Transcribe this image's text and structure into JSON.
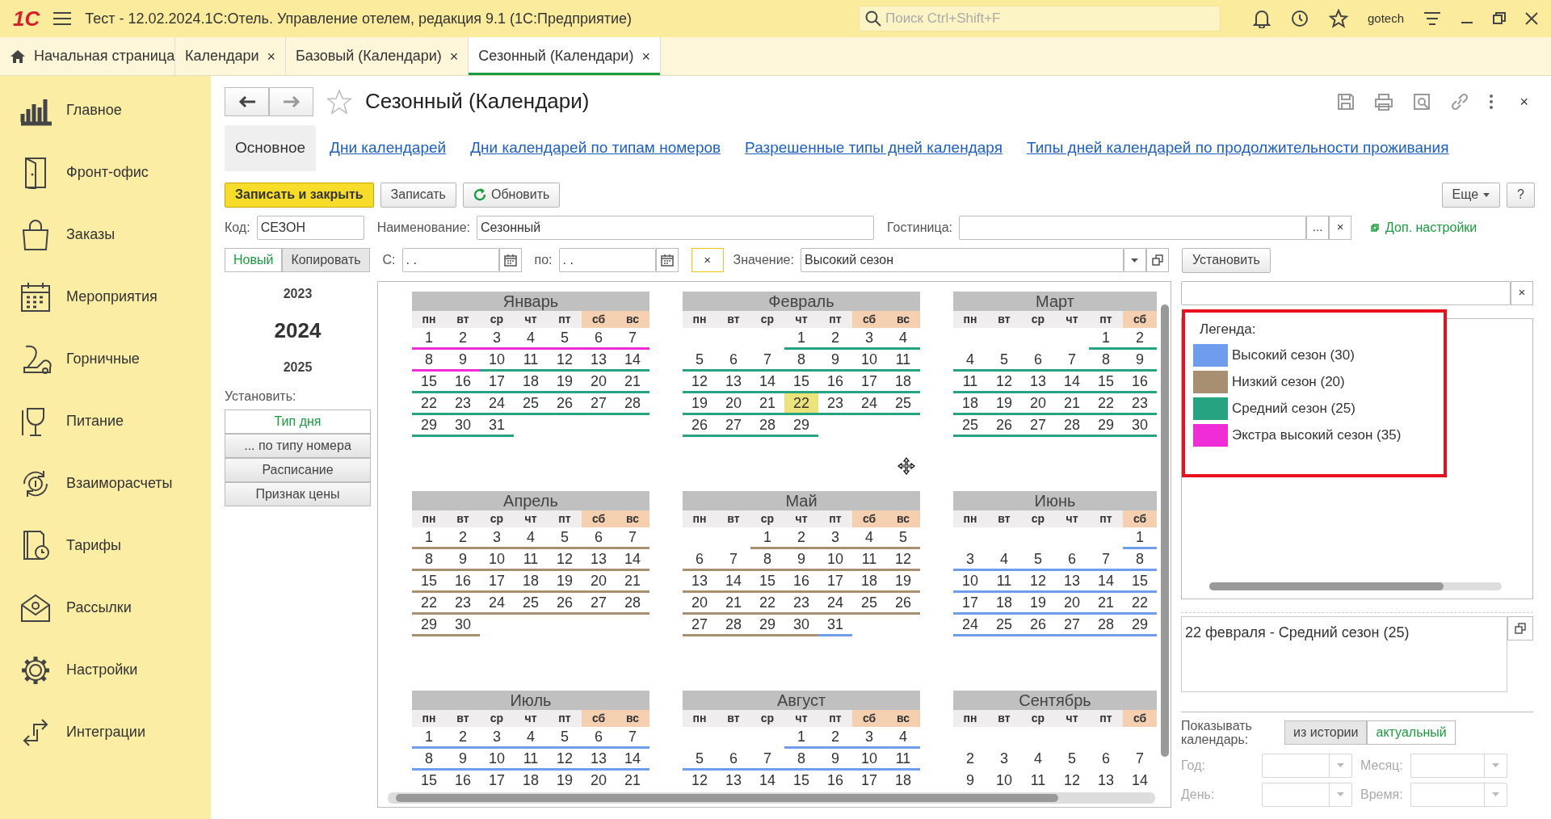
{
  "window": {
    "logo": "1С",
    "title": "Тест - 12.02.2024.1С:Отель. Управление отелем, редакция 9.1  (1С:Предприятие)",
    "search_placeholder": "Поиск Ctrl+Shift+F",
    "user": "gotech"
  },
  "tabs": [
    {
      "label": "Начальная страница",
      "selected": false,
      "kind": "home"
    },
    {
      "label": "Календари",
      "selected": false,
      "kind": "doc",
      "close": "×"
    },
    {
      "label": "Базовый (Календари)",
      "selected": false,
      "kind": "doc",
      "close": "×"
    },
    {
      "label": "Сезонный (Календари)",
      "selected": true,
      "kind": "doc",
      "close": "×"
    }
  ],
  "sidebar": [
    {
      "label": "Главное"
    },
    {
      "label": "Фронт-офис"
    },
    {
      "label": "Заказы"
    },
    {
      "label": "Мероприятия"
    },
    {
      "label": "Горничные"
    },
    {
      "label": "Питание"
    },
    {
      "label": "Взаиморасчеты"
    },
    {
      "label": "Тарифы"
    },
    {
      "label": "Рассылки"
    },
    {
      "label": "Настройки"
    },
    {
      "label": "Интеграции"
    }
  ],
  "form": {
    "title": "Сезонный (Календари)",
    "close": "×",
    "sections": [
      {
        "label": "Основное",
        "selected": true
      },
      {
        "label": "Дни календарей",
        "selected": false
      },
      {
        "label": "Дни календарей по типам номеров",
        "selected": false
      },
      {
        "label": "Разрешенные типы дней календаря",
        "selected": false
      },
      {
        "label": "Типы дней календарей по продолжительности проживания",
        "selected": false
      }
    ],
    "buttons": {
      "save_close": "Записать и закрыть",
      "save": "Записать",
      "refresh": "Обновить",
      "more": "Еще",
      "help": "?"
    },
    "code": {
      "label": "Код:",
      "value": "СЕЗОН"
    },
    "name": {
      "label": "Наименование:",
      "value": "Сезонный"
    },
    "hotel": {
      "label": "Гостиница:",
      "select": "...",
      "clear": "×"
    },
    "settings_link": "Доп. настройки",
    "modes": [
      {
        "label": "Новый",
        "selected": true
      },
      {
        "label": "Копировать",
        "selected": false
      }
    ],
    "from": {
      "label": "С:",
      "value": ". ."
    },
    "to": {
      "label": "по:",
      "value": ". ."
    },
    "clear": "×",
    "value": {
      "label": "Значение:",
      "value": "Высокий сезон"
    },
    "set_button": "Установить"
  },
  "years": [
    {
      "label": "2023",
      "selected": false
    },
    {
      "label": "2024",
      "selected": true
    },
    {
      "label": "2025",
      "selected": false
    }
  ],
  "set_label": "Установить:",
  "set_options": [
    {
      "label": "Тип дня",
      "selected": true
    },
    {
      "label": "... по типу номера",
      "selected": false
    },
    {
      "label": "Расписание",
      "selected": false
    },
    {
      "label": "Признак цены",
      "selected": false
    }
  ],
  "months": [
    {
      "name": "Январь",
      "weekdays": [
        {
          "label": "пн",
          "weekend": false
        },
        {
          "label": "вт",
          "weekend": false
        },
        {
          "label": "ср",
          "weekend": false
        },
        {
          "label": "чт",
          "weekend": false
        },
        {
          "label": "пт",
          "weekend": false
        },
        {
          "label": "сб",
          "weekend": true
        },
        {
          "label": "вс",
          "weekend": true
        }
      ],
      "weeks": [
        [
          {
            "day": "1",
            "color": "#f02cd7",
            "selected": false
          },
          {
            "day": "2",
            "color": "#f02cd7",
            "selected": false
          },
          {
            "day": "3",
            "color": "#f02cd7",
            "selected": false
          },
          {
            "day": "4",
            "color": "#f02cd7",
            "selected": false
          },
          {
            "day": "5",
            "color": "#f02cd7",
            "selected": false
          },
          {
            "day": "6",
            "color": "#f02cd7",
            "selected": false
          },
          {
            "day": "7",
            "color": "#f02cd7",
            "selected": false
          }
        ],
        [
          {
            "day": "8",
            "color": "#f02cd7",
            "selected": false
          },
          {
            "day": "9",
            "color": "#f02cd7",
            "selected": false
          },
          {
            "day": "10",
            "color": "#26a482",
            "selected": false
          },
          {
            "day": "11",
            "color": "#26a482",
            "selected": false
          },
          {
            "day": "12",
            "color": "#26a482",
            "selected": false
          },
          {
            "day": "13",
            "color": "#26a482",
            "selected": false
          },
          {
            "day": "14",
            "color": "#26a482",
            "selected": false
          }
        ],
        [
          {
            "day": "15",
            "color": "#26a482",
            "selected": false
          },
          {
            "day": "16",
            "color": "#26a482",
            "selected": false
          },
          {
            "day": "17",
            "color": "#26a482",
            "selected": false
          },
          {
            "day": "18",
            "color": "#26a482",
            "selected": false
          },
          {
            "day": "19",
            "color": "#26a482",
            "selected": false
          },
          {
            "day": "20",
            "color": "#26a482",
            "selected": false
          },
          {
            "day": "21",
            "color": "#26a482",
            "selected": false
          }
        ],
        [
          {
            "day": "22",
            "color": "#26a482",
            "selected": false
          },
          {
            "day": "23",
            "color": "#26a482",
            "selected": false
          },
          {
            "day": "24",
            "color": "#26a482",
            "selected": false
          },
          {
            "day": "25",
            "color": "#26a482",
            "selected": false
          },
          {
            "day": "26",
            "color": "#26a482",
            "selected": false
          },
          {
            "day": "27",
            "color": "#26a482",
            "selected": false
          },
          {
            "day": "28",
            "color": "#26a482",
            "selected": false
          }
        ],
        [
          {
            "day": "29",
            "color": "#26a482",
            "selected": false
          },
          {
            "day": "30",
            "color": "#26a482",
            "selected": false
          },
          {
            "day": "31",
            "color": "#26a482",
            "selected": false
          }
        ]
      ]
    },
    {
      "name": "Февраль",
      "weekdays": [
        {
          "label": "пн",
          "weekend": false
        },
        {
          "label": "вт",
          "weekend": false
        },
        {
          "label": "ср",
          "weekend": false
        },
        {
          "label": "чт",
          "weekend": false
        },
        {
          "label": "пт",
          "weekend": false
        },
        {
          "label": "сб",
          "weekend": true
        },
        {
          "label": "вс",
          "weekend": true
        }
      ],
      "weeks": [
        [
          {
            "day": "1",
            "color": "#26a482",
            "selected": false
          },
          {
            "day": "2",
            "color": "#26a482",
            "selected": false
          },
          {
            "day": "3",
            "color": "#26a482",
            "selected": false
          },
          {
            "day": "4",
            "color": "#26a482",
            "selected": false
          }
        ],
        [
          {
            "day": "5",
            "color": "#26a482",
            "selected": false
          },
          {
            "day": "6",
            "color": "#26a482",
            "selected": false
          },
          {
            "day": "7",
            "color": "#26a482",
            "selected": false
          },
          {
            "day": "8",
            "color": "#26a482",
            "selected": false
          },
          {
            "day": "9",
            "color": "#26a482",
            "selected": false
          },
          {
            "day": "10",
            "color": "#26a482",
            "selected": false
          },
          {
            "day": "11",
            "color": "#26a482",
            "selected": false
          }
        ],
        [
          {
            "day": "12",
            "color": "#26a482",
            "selected": false
          },
          {
            "day": "13",
            "color": "#26a482",
            "selected": false
          },
          {
            "day": "14",
            "color": "#26a482",
            "selected": false
          },
          {
            "day": "15",
            "color": "#26a482",
            "selected": false
          },
          {
            "day": "16",
            "color": "#26a482",
            "selected": false
          },
          {
            "day": "17",
            "color": "#26a482",
            "selected": false
          },
          {
            "day": "18",
            "color": "#26a482",
            "selected": false
          }
        ],
        [
          {
            "day": "19",
            "color": "#26a482",
            "selected": false
          },
          {
            "day": "20",
            "color": "#26a482",
            "selected": false
          },
          {
            "day": "21",
            "color": "#26a482",
            "selected": false
          },
          {
            "day": "22",
            "color": "#26a482",
            "selected": true
          },
          {
            "day": "23",
            "color": "#26a482",
            "selected": false
          },
          {
            "day": "24",
            "color": "#26a482",
            "selected": false
          },
          {
            "day": "25",
            "color": "#26a482",
            "selected": false
          }
        ],
        [
          {
            "day": "26",
            "color": "#26a482",
            "selected": false
          },
          {
            "day": "27",
            "color": "#26a482",
            "selected": false
          },
          {
            "day": "28",
            "color": "#26a482",
            "selected": false
          },
          {
            "day": "29",
            "color": "#26a482",
            "selected": false
          }
        ]
      ]
    },
    {
      "name": "Март",
      "weekdays": [
        {
          "label": "пн",
          "weekend": false
        },
        {
          "label": "вт",
          "weekend": false
        },
        {
          "label": "ср",
          "weekend": false
        },
        {
          "label": "чт",
          "weekend": false
        },
        {
          "label": "пт",
          "weekend": false
        },
        {
          "label": "сб",
          "weekend": true
        }
      ],
      "weeks": [
        [
          {
            "day": "1",
            "color": "#26a482",
            "selected": false
          },
          {
            "day": "2",
            "color": "#26a482",
            "selected": false
          }
        ],
        [
          {
            "day": "4",
            "color": "#26a482",
            "selected": false
          },
          {
            "day": "5",
            "color": "#26a482",
            "selected": false
          },
          {
            "day": "6",
            "color": "#26a482",
            "selected": false
          },
          {
            "day": "7",
            "color": "#26a482",
            "selected": false
          },
          {
            "day": "8",
            "color": "#26a482",
            "selected": false
          },
          {
            "day": "9",
            "color": "#26a482",
            "selected": false
          }
        ],
        [
          {
            "day": "11",
            "color": "#26a482",
            "selected": false
          },
          {
            "day": "12",
            "color": "#26a482",
            "selected": false
          },
          {
            "day": "13",
            "color": "#26a482",
            "selected": false
          },
          {
            "day": "14",
            "color": "#26a482",
            "selected": false
          },
          {
            "day": "15",
            "color": "#26a482",
            "selected": false
          },
          {
            "day": "16",
            "color": "#26a482",
            "selected": false
          }
        ],
        [
          {
            "day": "18",
            "color": "#26a482",
            "selected": false
          },
          {
            "day": "19",
            "color": "#26a482",
            "selected": false
          },
          {
            "day": "20",
            "color": "#26a482",
            "selected": false
          },
          {
            "day": "21",
            "color": "#26a482",
            "selected": false
          },
          {
            "day": "22",
            "color": "#26a482",
            "selected": false
          },
          {
            "day": "23",
            "color": "#26a482",
            "selected": false
          }
        ],
        [
          {
            "day": "25",
            "color": "#26a482",
            "selected": false
          },
          {
            "day": "26",
            "color": "#26a482",
            "selected": false
          },
          {
            "day": "27",
            "color": "#26a482",
            "selected": false
          },
          {
            "day": "28",
            "color": "#26a482",
            "selected": false
          },
          {
            "day": "29",
            "color": "#26a482",
            "selected": false
          },
          {
            "day": "30",
            "color": "#26a482",
            "selected": false
          }
        ]
      ]
    },
    {
      "name": "Апрель",
      "weekdays": [
        {
          "label": "пн",
          "weekend": false
        },
        {
          "label": "вт",
          "weekend": false
        },
        {
          "label": "ср",
          "weekend": false
        },
        {
          "label": "чт",
          "weekend": false
        },
        {
          "label": "пт",
          "weekend": false
        },
        {
          "label": "сб",
          "weekend": true
        },
        {
          "label": "вс",
          "weekend": true
        }
      ],
      "weeks": [
        [
          {
            "day": "1",
            "color": "#a88f72",
            "selected": false
          },
          {
            "day": "2",
            "color": "#a88f72",
            "selected": false
          },
          {
            "day": "3",
            "color": "#a88f72",
            "selected": false
          },
          {
            "day": "4",
            "color": "#a88f72",
            "selected": false
          },
          {
            "day": "5",
            "color": "#a88f72",
            "selected": false
          },
          {
            "day": "6",
            "color": "#a88f72",
            "selected": false
          },
          {
            "day": "7",
            "color": "#a88f72",
            "selected": false
          }
        ],
        [
          {
            "day": "8",
            "color": "#a88f72",
            "selected": false
          },
          {
            "day": "9",
            "color": "#a88f72",
            "selected": false
          },
          {
            "day": "10",
            "color": "#a88f72",
            "selected": false
          },
          {
            "day": "11",
            "color": "#a88f72",
            "selected": false
          },
          {
            "day": "12",
            "color": "#a88f72",
            "selected": false
          },
          {
            "day": "13",
            "color": "#a88f72",
            "selected": false
          },
          {
            "day": "14",
            "color": "#a88f72",
            "selected": false
          }
        ],
        [
          {
            "day": "15",
            "color": "#a88f72",
            "selected": false
          },
          {
            "day": "16",
            "color": "#a88f72",
            "selected": false
          },
          {
            "day": "17",
            "color": "#a88f72",
            "selected": false
          },
          {
            "day": "18",
            "color": "#a88f72",
            "selected": false
          },
          {
            "day": "19",
            "color": "#a88f72",
            "selected": false
          },
          {
            "day": "20",
            "color": "#a88f72",
            "selected": false
          },
          {
            "day": "21",
            "color": "#a88f72",
            "selected": false
          }
        ],
        [
          {
            "day": "22",
            "color": "#a88f72",
            "selected": false
          },
          {
            "day": "23",
            "color": "#a88f72",
            "selected": false
          },
          {
            "day": "24",
            "color": "#a88f72",
            "selected": false
          },
          {
            "day": "25",
            "color": "#a88f72",
            "selected": false
          },
          {
            "day": "26",
            "color": "#a88f72",
            "selected": false
          },
          {
            "day": "27",
            "color": "#a88f72",
            "selected": false
          },
          {
            "day": "28",
            "color": "#a88f72",
            "selected": false
          }
        ],
        [
          {
            "day": "29",
            "color": "#a88f72",
            "selected": false
          },
          {
            "day": "30",
            "color": "#a88f72",
            "selected": false
          }
        ]
      ]
    },
    {
      "name": "Май",
      "weekdays": [
        {
          "label": "пн",
          "weekend": false
        },
        {
          "label": "вт",
          "weekend": false
        },
        {
          "label": "ср",
          "weekend": false
        },
        {
          "label": "чт",
          "weekend": false
        },
        {
          "label": "пт",
          "weekend": false
        },
        {
          "label": "сб",
          "weekend": true
        },
        {
          "label": "вс",
          "weekend": true
        }
      ],
      "weeks": [
        [
          {
            "day": "1",
            "color": "#a88f72",
            "selected": false
          },
          {
            "day": "2",
            "color": "#a88f72",
            "selected": false
          },
          {
            "day": "3",
            "color": "#a88f72",
            "selected": false
          },
          {
            "day": "4",
            "color": "#a88f72",
            "selected": false
          },
          {
            "day": "5",
            "color": "#a88f72",
            "selected": false
          }
        ],
        [
          {
            "day": "6",
            "color": "#a88f72",
            "selected": false
          },
          {
            "day": "7",
            "color": "#a88f72",
            "selected": false
          },
          {
            "day": "8",
            "color": "#a88f72",
            "selected": false
          },
          {
            "day": "9",
            "color": "#a88f72",
            "selected": false
          },
          {
            "day": "10",
            "color": "#a88f72",
            "selected": false
          },
          {
            "day": "11",
            "color": "#a88f72",
            "selected": false
          },
          {
            "day": "12",
            "color": "#a88f72",
            "selected": false
          }
        ],
        [
          {
            "day": "13",
            "color": "#a88f72",
            "selected": false
          },
          {
            "day": "14",
            "color": "#a88f72",
            "selected": false
          },
          {
            "day": "15",
            "color": "#a88f72",
            "selected": false
          },
          {
            "day": "16",
            "color": "#a88f72",
            "selected": false
          },
          {
            "day": "17",
            "color": "#a88f72",
            "selected": false
          },
          {
            "day": "18",
            "color": "#a88f72",
            "selected": false
          },
          {
            "day": "19",
            "color": "#a88f72",
            "selected": false
          }
        ],
        [
          {
            "day": "20",
            "color": "#a88f72",
            "selected": false
          },
          {
            "day": "21",
            "color": "#a88f72",
            "selected": false
          },
          {
            "day": "22",
            "color": "#a88f72",
            "selected": false
          },
          {
            "day": "23",
            "color": "#a88f72",
            "selected": false
          },
          {
            "day": "24",
            "color": "#a88f72",
            "selected": false
          },
          {
            "day": "25",
            "color": "#a88f72",
            "selected": false
          },
          {
            "day": "26",
            "color": "#a88f72",
            "selected": false
          }
        ],
        [
          {
            "day": "27",
            "color": "#a88f72",
            "selected": false
          },
          {
            "day": "28",
            "color": "#a88f72",
            "selected": false
          },
          {
            "day": "29",
            "color": "#a88f72",
            "selected": false
          },
          {
            "day": "30",
            "color": "#a88f72",
            "selected": false
          },
          {
            "day": "31",
            "color": "#6f9ced",
            "selected": false
          }
        ]
      ]
    },
    {
      "name": "Июнь",
      "weekdays": [
        {
          "label": "пн",
          "weekend": false
        },
        {
          "label": "вт",
          "weekend": false
        },
        {
          "label": "ср",
          "weekend": false
        },
        {
          "label": "чт",
          "weekend": false
        },
        {
          "label": "пт",
          "weekend": false
        },
        {
          "label": "сб",
          "weekend": true
        }
      ],
      "weeks": [
        [
          {
            "day": "1",
            "color": "#6f9ced",
            "selected": false
          }
        ],
        [
          {
            "day": "3",
            "color": "#6f9ced",
            "selected": false
          },
          {
            "day": "4",
            "color": "#6f9ced",
            "selected": false
          },
          {
            "day": "5",
            "color": "#6f9ced",
            "selected": false
          },
          {
            "day": "6",
            "color": "#6f9ced",
            "selected": false
          },
          {
            "day": "7",
            "color": "#6f9ced",
            "selected": false
          },
          {
            "day": "8",
            "color": "#6f9ced",
            "selected": false
          }
        ],
        [
          {
            "day": "10",
            "color": "#6f9ced",
            "selected": false
          },
          {
            "day": "11",
            "color": "#6f9ced",
            "selected": false
          },
          {
            "day": "12",
            "color": "#6f9ced",
            "selected": false
          },
          {
            "day": "13",
            "color": "#6f9ced",
            "selected": false
          },
          {
            "day": "14",
            "color": "#6f9ced",
            "selected": false
          },
          {
            "day": "15",
            "color": "#6f9ced",
            "selected": false
          }
        ],
        [
          {
            "day": "17",
            "color": "#6f9ced",
            "selected": false
          },
          {
            "day": "18",
            "color": "#6f9ced",
            "selected": false
          },
          {
            "day": "19",
            "color": "#6f9ced",
            "selected": false
          },
          {
            "day": "20",
            "color": "#6f9ced",
            "selected": false
          },
          {
            "day": "21",
            "color": "#6f9ced",
            "selected": false
          },
          {
            "day": "22",
            "color": "#6f9ced",
            "selected": false
          }
        ],
        [
          {
            "day": "24",
            "color": "#6f9ced",
            "selected": false
          },
          {
            "day": "25",
            "color": "#6f9ced",
            "selected": false
          },
          {
            "day": "26",
            "color": "#6f9ced",
            "selected": false
          },
          {
            "day": "27",
            "color": "#6f9ced",
            "selected": false
          },
          {
            "day": "28",
            "color": "#6f9ced",
            "selected": false
          },
          {
            "day": "29",
            "color": "#6f9ced",
            "selected": false
          }
        ]
      ]
    },
    {
      "name": "Июль",
      "weekdays": [
        {
          "label": "пн",
          "weekend": false
        },
        {
          "label": "вт",
          "weekend": false
        },
        {
          "label": "ср",
          "weekend": false
        },
        {
          "label": "чт",
          "weekend": false
        },
        {
          "label": "пт",
          "weekend": false
        },
        {
          "label": "сб",
          "weekend": true
        },
        {
          "label": "вс",
          "weekend": true
        }
      ],
      "weeks": [
        [
          {
            "day": "1",
            "color": "#6f9ced",
            "selected": false
          },
          {
            "day": "2",
            "color": "#6f9ced",
            "selected": false
          },
          {
            "day": "3",
            "color": "#6f9ced",
            "selected": false
          },
          {
            "day": "4",
            "color": "#6f9ced",
            "selected": false
          },
          {
            "day": "5",
            "color": "#6f9ced",
            "selected": false
          },
          {
            "day": "6",
            "color": "#6f9ced",
            "selected": false
          },
          {
            "day": "7",
            "color": "#6f9ced",
            "selected": false
          }
        ],
        [
          {
            "day": "8",
            "color": "#6f9ced",
            "selected": false
          },
          {
            "day": "9",
            "color": "#6f9ced",
            "selected": false
          },
          {
            "day": "10",
            "color": "#6f9ced",
            "selected": false
          },
          {
            "day": "11",
            "color": "#6f9ced",
            "selected": false
          },
          {
            "day": "12",
            "color": "#6f9ced",
            "selected": false
          },
          {
            "day": "13",
            "color": "#6f9ced",
            "selected": false
          },
          {
            "day": "14",
            "color": "#6f9ced",
            "selected": false
          }
        ],
        [
          {
            "day": "15",
            "selected": false
          },
          {
            "day": "16",
            "selected": false
          },
          {
            "day": "17",
            "selected": false
          },
          {
            "day": "18",
            "selected": false
          },
          {
            "day": "19",
            "selected": false
          },
          {
            "day": "20",
            "selected": false
          },
          {
            "day": "21",
            "selected": false
          }
        ]
      ]
    },
    {
      "name": "Август",
      "weekdays": [
        {
          "label": "пн",
          "weekend": false
        },
        {
          "label": "вт",
          "weekend": false
        },
        {
          "label": "ср",
          "weekend": false
        },
        {
          "label": "чт",
          "weekend": false
        },
        {
          "label": "пт",
          "weekend": false
        },
        {
          "label": "сб",
          "weekend": true
        },
        {
          "label": "вс",
          "weekend": true
        }
      ],
      "weeks": [
        [
          {
            "day": "1",
            "color": "#6f9ced",
            "selected": false
          },
          {
            "day": "2",
            "color": "#6f9ced",
            "selected": false
          },
          {
            "day": "3",
            "color": "#6f9ced",
            "selected": false
          },
          {
            "day": "4",
            "color": "#6f9ced",
            "selected": false
          }
        ],
        [
          {
            "day": "5",
            "color": "#6f9ced",
            "selected": false
          },
          {
            "day": "6",
            "color": "#6f9ced",
            "selected": false
          },
          {
            "day": "7",
            "color": "#6f9ced",
            "selected": false
          },
          {
            "day": "8",
            "color": "#6f9ced",
            "selected": false
          },
          {
            "day": "9",
            "color": "#6f9ced",
            "selected": false
          },
          {
            "day": "10",
            "color": "#6f9ced",
            "selected": false
          },
          {
            "day": "11",
            "color": "#6f9ced",
            "selected": false
          }
        ],
        [
          {
            "day": "12",
            "selected": false
          },
          {
            "day": "13",
            "selected": false
          },
          {
            "day": "14",
            "selected": false
          },
          {
            "day": "15",
            "selected": false
          },
          {
            "day": "16",
            "selected": false
          },
          {
            "day": "17",
            "selected": false
          },
          {
            "day": "18",
            "selected": false
          }
        ]
      ]
    },
    {
      "name": "Сентябрь",
      "weekdays": [
        {
          "label": "пн",
          "weekend": false
        },
        {
          "label": "вт",
          "weekend": false
        },
        {
          "label": "ср",
          "weekend": false
        },
        {
          "label": "чт",
          "weekend": false
        },
        {
          "label": "пт",
          "weekend": false
        },
        {
          "label": "сб",
          "weekend": true
        }
      ],
      "blank_first_week": true,
      "weeks": [
        [
          {
            "day": "2",
            "selected": false
          },
          {
            "day": "3",
            "selected": false
          },
          {
            "day": "4",
            "selected": false
          },
          {
            "day": "5",
            "selected": false
          },
          {
            "day": "6",
            "selected": false
          },
          {
            "day": "7",
            "selected": false
          }
        ],
        [
          {
            "day": "9",
            "selected": false
          },
          {
            "day": "10",
            "selected": false
          },
          {
            "day": "11",
            "selected": false
          },
          {
            "day": "12",
            "selected": false
          },
          {
            "day": "13",
            "selected": false
          },
          {
            "day": "14",
            "selected": false
          }
        ]
      ]
    }
  ],
  "panel_close": "×",
  "legend": {
    "title": "Легенда:",
    "highlighted": true,
    "items": [
      {
        "label": "Высокий сезон (30)",
        "color": "#6f9ced"
      },
      {
        "label": "Низкий сезон (20)",
        "color": "#a88f72"
      },
      {
        "label": "Средний сезон (25)",
        "color": "#26a482"
      },
      {
        "label": "Экстра высокий сезон (35)",
        "color": "#f02cd7"
      }
    ]
  },
  "info": "22 февраля - Средний сезон (25)",
  "show": {
    "label": "Показывать календарь:",
    "options": [
      {
        "label": "из истории",
        "selected": false
      },
      {
        "label": "актуальный",
        "selected": true
      }
    ]
  },
  "filters": [
    {
      "label": "Год:",
      "disabled": true
    },
    {
      "label": "Месяц:",
      "disabled": true
    },
    {
      "label": "День:",
      "disabled": true
    },
    {
      "label": "Время:",
      "disabled": true
    }
  ]
}
